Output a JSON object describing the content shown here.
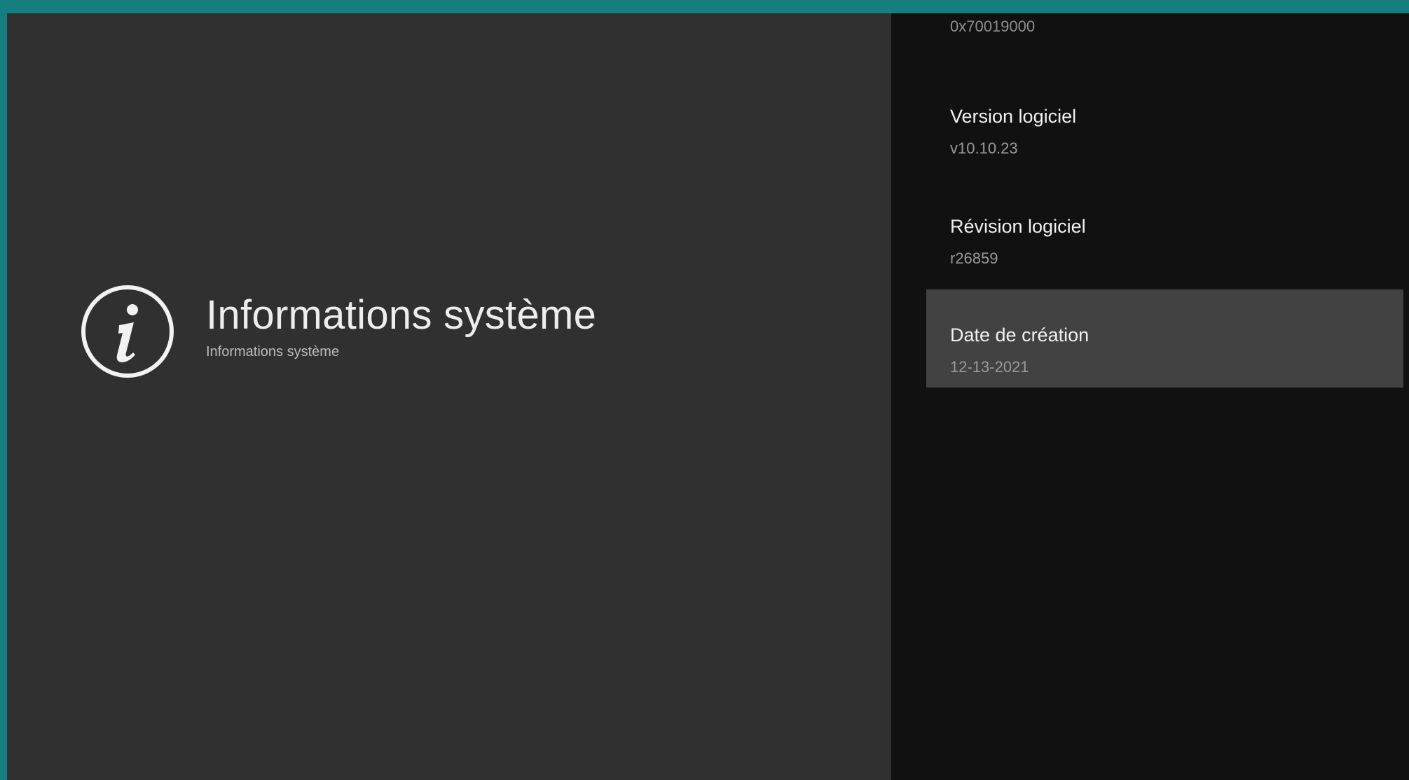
{
  "header": {
    "icon": "info-circle-icon",
    "title": "Informations système",
    "subtitle": "Informations système"
  },
  "details": {
    "partial_top_value": "0x70019000",
    "items": [
      {
        "label": "Version logiciel",
        "value": "v10.10.23",
        "selected": false
      },
      {
        "label": "Révision logiciel",
        "value": "r26859",
        "selected": false
      },
      {
        "label": "Date de création",
        "value": "12-13-2021",
        "selected": true
      }
    ]
  },
  "colors": {
    "frame": "#157f80",
    "left_background": "#303030",
    "right_background": "#111111",
    "selected_background": "#424242"
  }
}
